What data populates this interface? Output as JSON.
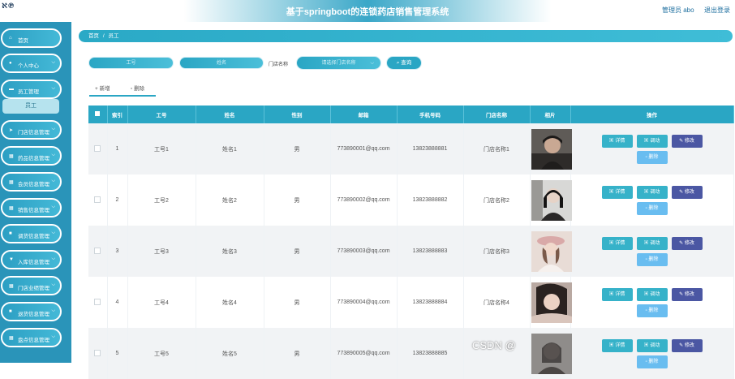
{
  "header": {
    "logo": "ℵ℗",
    "title": "基于springboot的连锁药店销售管理系统",
    "admin": "管理员 abo",
    "logout": "退出登录"
  },
  "sidebar": {
    "items": [
      {
        "icon": "home-icon",
        "glyph": "⌂",
        "label": "首页",
        "chevron": false
      },
      {
        "icon": "person-icon",
        "glyph": "●",
        "label": "个人中心",
        "chevron": true
      },
      {
        "icon": "monitor-icon",
        "glyph": "▬",
        "label": "员工管理",
        "chevron": true
      },
      {
        "icon": "send-icon",
        "glyph": "➤",
        "label": "门店信息管理",
        "chevron": true
      },
      {
        "icon": "grid-icon",
        "glyph": "▦",
        "label": "药品信息管理",
        "chevron": true
      },
      {
        "icon": "grid-icon",
        "glyph": "▦",
        "label": "会员信息管理",
        "chevron": true
      },
      {
        "icon": "grid-icon",
        "glyph": "▦",
        "label": "销售信息管理",
        "chevron": true
      },
      {
        "icon": "lock-icon",
        "glyph": "■",
        "label": "调货信息管理",
        "chevron": true
      },
      {
        "icon": "shield-icon",
        "glyph": "▼",
        "label": "入库信息管理",
        "chevron": true
      },
      {
        "icon": "grid-icon",
        "glyph": "▦",
        "label": "门店业绩管理",
        "chevron": true
      },
      {
        "icon": "lock-icon",
        "glyph": "■",
        "label": "退货信息管理",
        "chevron": true
      },
      {
        "icon": "grid-icon",
        "glyph": "▦",
        "label": "盘点信息管理",
        "chevron": true
      }
    ],
    "sub_item": "员工"
  },
  "breadcrumb": {
    "home": "首页",
    "separator": "/",
    "current": "员工"
  },
  "search": {
    "emp_no_placeholder": "工号",
    "name_placeholder": "姓名",
    "store_label": "门店名称",
    "store_placeholder": "请选择门店名称",
    "query_label": "查询"
  },
  "actions": {
    "add": "+ 新增",
    "delete": "删除"
  },
  "table": {
    "headers": [
      "",
      "索引",
      "工号",
      "姓名",
      "性别",
      "邮箱",
      "手机号码",
      "门店名称",
      "相片",
      "操作"
    ],
    "rows": [
      {
        "index": "1",
        "emp_no": "工号1",
        "name": "姓名1",
        "gender": "男",
        "email": "773890001@qq.com",
        "phone": "13823888881",
        "store": "门店名称1"
      },
      {
        "index": "2",
        "emp_no": "工号2",
        "name": "姓名2",
        "gender": "男",
        "email": "773890002@qq.com",
        "phone": "13823888882",
        "store": "门店名称2"
      },
      {
        "index": "3",
        "emp_no": "工号3",
        "name": "姓名3",
        "gender": "男",
        "email": "773890003@qq.com",
        "phone": "13823888883",
        "store": "门店名称3"
      },
      {
        "index": "4",
        "emp_no": "工号4",
        "name": "姓名4",
        "gender": "男",
        "email": "773890004@qq.com",
        "phone": "13823888884",
        "store": "门店名称4"
      },
      {
        "index": "5",
        "emp_no": "工号5",
        "name": "姓名5",
        "gender": "男",
        "email": "773890005@qq.com",
        "phone": "13823888885",
        "store": ""
      }
    ],
    "ops": {
      "detail": "详情",
      "move": "调动",
      "edit": "修改",
      "delete": "删除"
    }
  },
  "watermark": "CSDN @",
  "colors": {
    "accent": "#2aa6c4",
    "sidebar": "#2a94b9",
    "edit": "#4b57a3",
    "delete": "#69bdf0"
  }
}
